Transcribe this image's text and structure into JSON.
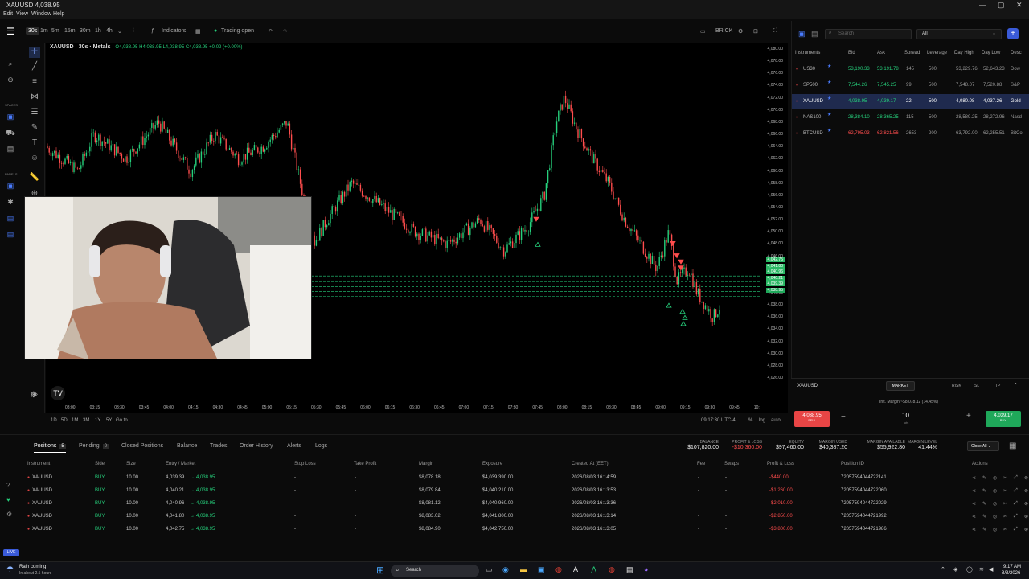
{
  "window": {
    "title": "XAUUSD 4,038.95"
  },
  "menu": [
    "Edit",
    "View",
    "Window",
    "Help"
  ],
  "toolbar": {
    "timeframes": [
      "30s",
      "1m",
      "5m",
      "15m",
      "30m",
      "1h",
      "4h"
    ],
    "active_timeframe": "30s",
    "indicators_label": "Indicators",
    "trading_status": "Trading open",
    "chart_type_label": "BRICK"
  },
  "left_sections": [
    "SPACES",
    "PANELS"
  ],
  "legend": {
    "symbol": "XAUUSD · 30s · Metals",
    "ohlc": "O4,038.95 H4,038.95 L4,038.95 C4,038.95 +0.02 (+0.00%)"
  },
  "price_axis": [
    "4,080.00",
    "4,078.00",
    "4,076.00",
    "4,074.00",
    "4,072.00",
    "4,070.00",
    "4,068.00",
    "4,066.00",
    "4,064.00",
    "4,062.00",
    "4,060.00",
    "4,058.00",
    "4,056.00",
    "4,054.00",
    "4,052.00",
    "4,050.00",
    "4,048.00",
    "4,046.00",
    "4,044.00",
    "4,042.00",
    "4,040.00",
    "4,038.00",
    "4,036.00",
    "4,034.00",
    "4,032.00",
    "4,030.00",
    "4,028.00",
    "4,026.00"
  ],
  "position_labels": [
    "4,042.75",
    "4,041.80",
    "4,040.96",
    "4,040.21",
    "4,039.39",
    "4,038.95"
  ],
  "time_axis": [
    "03:00",
    "03:15",
    "03:30",
    "03:45",
    "04:00",
    "04:15",
    "04:30",
    "04:45",
    "05:00",
    "05:15",
    "05:30",
    "05:45",
    "06:00",
    "06:15",
    "06:30",
    "06:45",
    "07:00",
    "07:15",
    "07:30",
    "07:45",
    "08:00",
    "08:15",
    "08:30",
    "08:45",
    "09:00",
    "09:15",
    "09:30",
    "09:45",
    "10:"
  ],
  "range_bar": {
    "ranges": [
      "1D",
      "5D",
      "1M",
      "3M",
      "1Y",
      "5Y"
    ],
    "goto": "Go to",
    "clock": "09:17:30 UTC-4",
    "percent": "%",
    "log": "log",
    "auto": "auto"
  },
  "instruments": {
    "search_placeholder": "Search",
    "filter": "All",
    "headers": [
      "Instruments",
      "Bid",
      "Ask",
      "Spread",
      "Leverage",
      "Day High",
      "Day Low",
      "Desc"
    ],
    "rows": [
      {
        "name": "US30",
        "bid": "53,190.33",
        "ask": "53,191.78",
        "spread": "145",
        "leverage": "500",
        "high": "53,229.76",
        "low": "52,643.23",
        "desc": "Dow",
        "selected": false,
        "color": "bid"
      },
      {
        "name": "SP500",
        "bid": "7,544.26",
        "ask": "7,545.25",
        "spread": "99",
        "leverage": "500",
        "high": "7,548.07",
        "low": "7,520.88",
        "desc": "S&P",
        "selected": false,
        "color": "bid"
      },
      {
        "name": "XAUUSD",
        "bid": "4,038.95",
        "ask": "4,039.17",
        "spread": "22",
        "leverage": "500",
        "high": "4,080.08",
        "low": "4,037.26",
        "desc": "Gold",
        "selected": true,
        "color": "bid"
      },
      {
        "name": "NAS100",
        "bid": "28,384.10",
        "ask": "28,365.25",
        "spread": "115",
        "leverage": "500",
        "high": "28,589.25",
        "low": "28,272.96",
        "desc": "Nasd",
        "selected": false,
        "color": "bid"
      },
      {
        "name": "BTCUSD",
        "bid": "62,795.03",
        "ask": "62,821.56",
        "spread": "2653",
        "leverage": "200",
        "high": "63,792.00",
        "low": "62,255.51",
        "desc": "BitCo",
        "selected": false,
        "color": "red"
      }
    ]
  },
  "order_panel": {
    "symbol": "XAUUSD",
    "order_type": "MARKET",
    "tabs": [
      "RISK",
      "SL",
      "TP"
    ],
    "init_margin": "Init. Margin ~$8,078.12 (14.45%)",
    "sell_price": "4,038.95",
    "sell_label": "SELL",
    "buy_price": "4,039.17",
    "buy_label": "BUY",
    "lots_value": "10",
    "lots_label": "lots",
    "minus": "−",
    "plus": "+"
  },
  "bottom_tabs": [
    {
      "label": "Positions",
      "count": "5",
      "active": true
    },
    {
      "label": "Pending",
      "count": "0",
      "active": false
    },
    {
      "label": "Closed Positions",
      "count": "",
      "active": false
    },
    {
      "label": "Balance",
      "count": "",
      "active": false
    },
    {
      "label": "Trades",
      "count": "",
      "active": false
    },
    {
      "label": "Order History",
      "count": "",
      "active": false
    },
    {
      "label": "Alerts",
      "count": "",
      "active": false
    },
    {
      "label": "Logs",
      "count": "",
      "active": false
    }
  ],
  "account_stats": [
    {
      "label": "BALANCE",
      "value": "$107,820.00",
      "color": "#eeeeee"
    },
    {
      "label": "PROFIT & LOSS",
      "value": "-$10,360.00",
      "color": "#ff4d4d"
    },
    {
      "label": "EQUITY",
      "value": "$97,460.00",
      "color": "#eeeeee"
    },
    {
      "label": "MARGIN USED",
      "value": "$40,387.20",
      "color": "#eeeeee"
    },
    {
      "label": "MARGIN AVAILABLE",
      "value": "$55,922.80",
      "color": "#eeeeee"
    },
    {
      "label": "MARGIN LEVEL",
      "value": "41.44%",
      "color": "#eeeeee"
    }
  ],
  "close_all": "Close All",
  "positions_headers": [
    "Instrument",
    "Side",
    "Size",
    "Entry / Market",
    "Stop Loss",
    "Take Profit",
    "Margin",
    "Exposure",
    "Created At (EET)",
    "Fee",
    "Swaps",
    "Profit & Loss",
    "Position ID",
    "Actions"
  ],
  "positions": [
    {
      "instrument": "XAUUSD",
      "side": "BUY",
      "size": "10.00",
      "entry": "4,039.39",
      "market": "4,038.95",
      "sl": "-",
      "tp": "-",
      "margin": "$8,078.18",
      "exposure": "$4,039,390.00",
      "created": "2026/08/03 16:14:59",
      "fee": "-",
      "swaps": "-",
      "pnl": "-$440.00",
      "id": "7205759404472214​1"
    },
    {
      "instrument": "XAUUSD",
      "side": "BUY",
      "size": "10.00",
      "entry": "4,040.21",
      "market": "4,038.95",
      "sl": "-",
      "tp": "-",
      "margin": "$8,079.84",
      "exposure": "$4,040,210.00",
      "created": "2026/08/03 16:13:53",
      "fee": "-",
      "swaps": "-",
      "pnl": "-$1,260.00",
      "id": "72057594044722060"
    },
    {
      "instrument": "XAUUSD",
      "side": "BUY",
      "size": "10.00",
      "entry": "4,040.96",
      "market": "4,038.95",
      "sl": "-",
      "tp": "-",
      "margin": "$8,081.12",
      "exposure": "$4,040,960.00",
      "created": "2026/08/03 16:13:36",
      "fee": "-",
      "swaps": "-",
      "pnl": "-$2,010.00",
      "id": "72057594044722029"
    },
    {
      "instrument": "XAUUSD",
      "side": "BUY",
      "size": "10.00",
      "entry": "4,041.80",
      "market": "4,038.95",
      "sl": "-",
      "tp": "-",
      "margin": "$8,083.02",
      "exposure": "$4,041,800.00",
      "created": "2026/08/03 16:13:14",
      "fee": "-",
      "swaps": "-",
      "pnl": "-$2,850.00",
      "id": "72057594044721992"
    },
    {
      "instrument": "XAUUSD",
      "side": "BUY",
      "size": "10.00",
      "entry": "4,042.75",
      "market": "4,038.95",
      "sl": "-",
      "tp": "-",
      "margin": "$8,084.90",
      "exposure": "$4,042,750.00",
      "created": "2026/08/03 16:13:05",
      "fee": "-",
      "swaps": "-",
      "pnl": "-$3,800.00",
      "id": "72057594044721986"
    }
  ],
  "live_badge": "LIVE",
  "taskbar": {
    "weather_title": "Rain coming",
    "weather_sub": "In about 2.5 hours",
    "search": "Search",
    "time": "9:17 AM",
    "date": "8/3/2026"
  },
  "colors": {
    "bid": "#26d07c",
    "red": "#ff4d4d",
    "accent": "#3a5bd9"
  }
}
